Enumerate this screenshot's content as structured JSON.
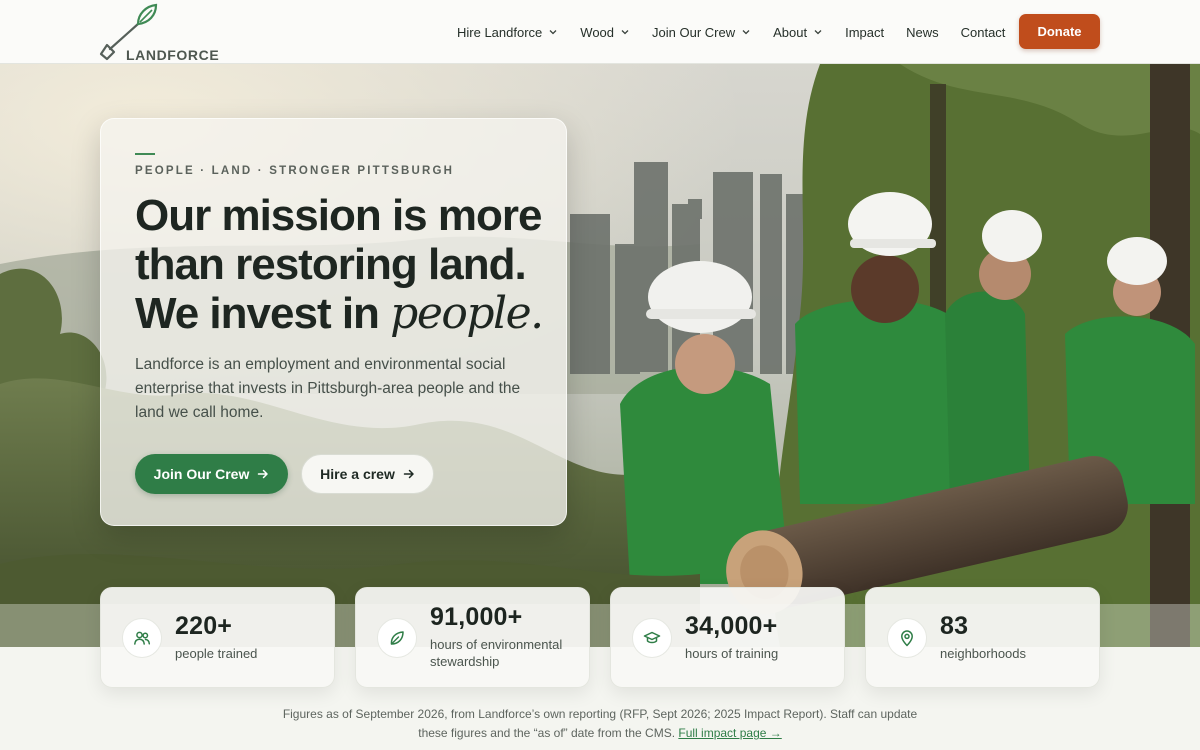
{
  "brand": {
    "name": "LANDFORCE",
    "accent": "#2f7d47",
    "cta_color": "#c04d1c"
  },
  "nav": {
    "items": [
      {
        "label": "Hire Landforce",
        "has_dropdown": true
      },
      {
        "label": "Wood",
        "has_dropdown": true
      },
      {
        "label": "Join Our Crew",
        "has_dropdown": true
      },
      {
        "label": "About",
        "has_dropdown": true
      },
      {
        "label": "Impact",
        "has_dropdown": false
      },
      {
        "label": "News",
        "has_dropdown": false
      },
      {
        "label": "Contact",
        "has_dropdown": false
      }
    ],
    "donate_label": "Donate"
  },
  "hero": {
    "eyebrow": "PEOPLE · LAND · STRONGER PITTSBURGH",
    "headline_line1": "Our mission is more",
    "headline_line2": "than restoring land.",
    "headline_line3_prefix": "We invest in ",
    "headline_emphasis": "people.",
    "lede": "Landforce is an employment and environmental social enterprise that invests in Pittsburgh-area people and the land we call home.",
    "primary_cta": "Join Our Crew",
    "secondary_cta": "Hire a crew"
  },
  "stats": [
    {
      "icon": "people-icon",
      "value": "220+",
      "label": "people trained"
    },
    {
      "icon": "leaf-icon",
      "value": "91,000+",
      "label": "hours of environmental stewardship"
    },
    {
      "icon": "graduation-cap-icon",
      "value": "34,000+",
      "label": "hours of training"
    },
    {
      "icon": "map-pin-icon",
      "value": "83",
      "label": "neighborhoods"
    }
  ],
  "footnote": {
    "text": "Figures as of September 2026, from Landforce’s own reporting (RFP, Sept 2026; 2025 Impact Report). Staff can update these figures and the “as of” date from the CMS.",
    "link_label": "Full impact page →"
  }
}
